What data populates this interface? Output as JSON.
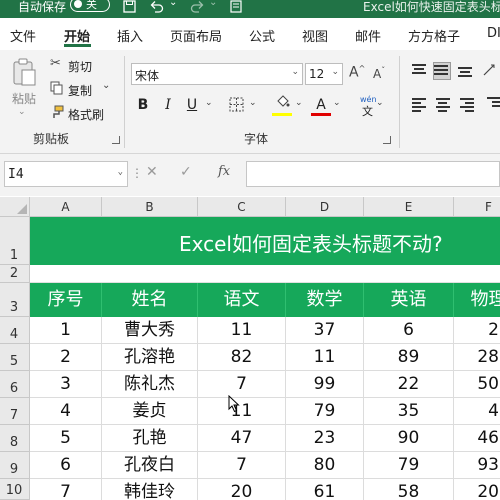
{
  "titlebar": {
    "autosave_label": "自动保存",
    "toggle_state": "关",
    "doc_title": "Excel如何快速固定表头标题"
  },
  "tabs": [
    "文件",
    "开始",
    "插入",
    "页面布局",
    "公式",
    "视图",
    "邮件",
    "方方格子",
    "DI"
  ],
  "active_tab": "开始",
  "clipboard": {
    "paste_label": "粘贴",
    "cut_label": "剪切",
    "copy_label": "复制",
    "format_painter_label": "格式刷",
    "group_label": "剪贴板"
  },
  "font": {
    "font_name": "宋体",
    "font_size": "12",
    "group_label": "字体",
    "bold": "B",
    "italic": "I",
    "underline": "U",
    "font_color_glyph": "A",
    "phonetic_top": "wén",
    "phonetic_bottom": "文",
    "grow_glyph": "A^",
    "shrink_glyph": "Aˇ",
    "fill_color": "#ffff00",
    "font_color": "#e00000"
  },
  "formula_bar": {
    "name_box": "I4",
    "fx_label": "fx",
    "formula": ""
  },
  "columns": [
    "A",
    "B",
    "C",
    "D",
    "E",
    "F"
  ],
  "rows": [
    "1",
    "2",
    "3",
    "4",
    "5",
    "6",
    "7",
    "8",
    "9",
    "10"
  ],
  "sheet": {
    "title": "Excel如何固定表头标题不动?",
    "headers": [
      "序号",
      "姓名",
      "语文",
      "数学",
      "英语",
      "物理"
    ],
    "data": [
      [
        "1",
        "曹大秀",
        "11",
        "37",
        "6",
        "2"
      ],
      [
        "2",
        "孔溶艳",
        "82",
        "11",
        "89",
        "28"
      ],
      [
        "3",
        "陈礼杰",
        "7",
        "99",
        "22",
        "50"
      ],
      [
        "4",
        "姜贞",
        "11",
        "79",
        "35",
        "4"
      ],
      [
        "5",
        "孔艳",
        "47",
        "23",
        "90",
        "46"
      ],
      [
        "6",
        "孔夜白",
        "7",
        "80",
        "79",
        "93"
      ],
      [
        "7",
        "韩佳玲",
        "20",
        "61",
        "58",
        "20"
      ]
    ]
  },
  "colors": {
    "titlebar": "#217346",
    "header_green": "#16a85a",
    "accent": "#217346"
  }
}
